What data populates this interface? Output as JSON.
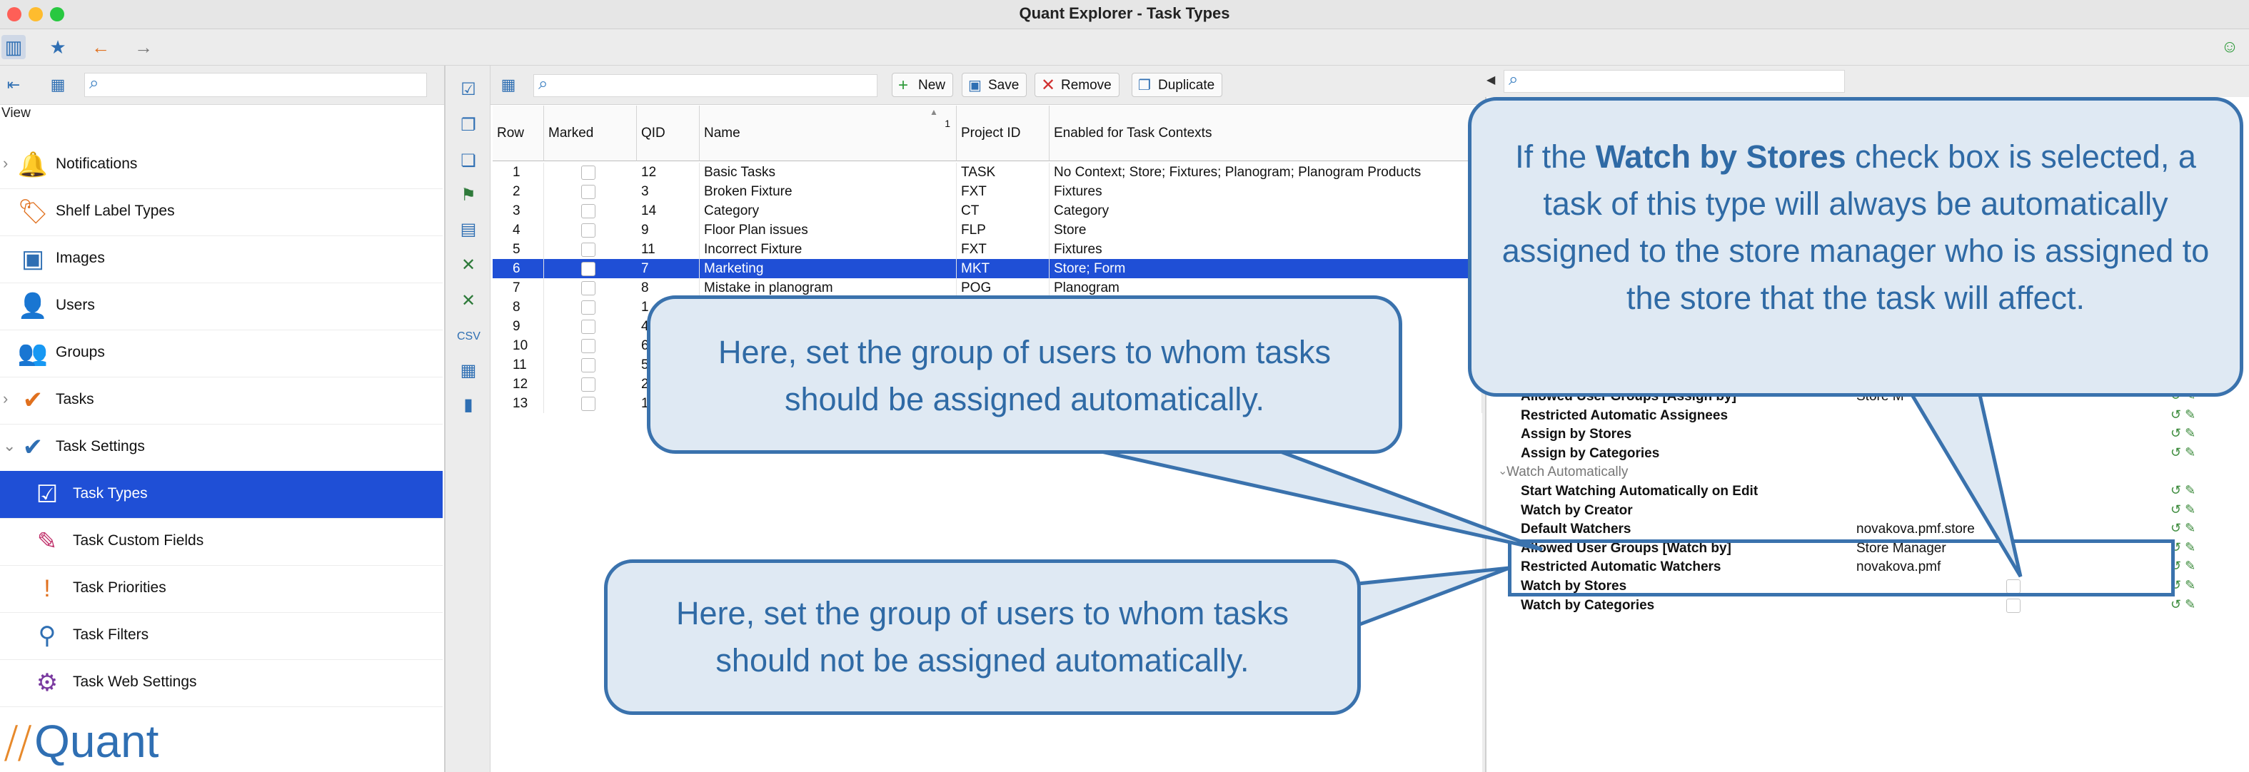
{
  "window": {
    "title": "Quant Explorer - Task Types"
  },
  "toolbar": {
    "icons": [
      "sidebar-toggle-icon",
      "star-icon",
      "back-arrow-icon",
      "forward-arrow-icon",
      "smiley-icon"
    ]
  },
  "left": {
    "search_placeholder": "",
    "view_label": "View",
    "items": [
      {
        "label": "Notifications",
        "icon": "bell-icon",
        "expandable": true
      },
      {
        "label": "Shelf Label Types",
        "icon": "label-icon",
        "expandable": false
      },
      {
        "label": "Images",
        "icon": "image-icon",
        "expandable": false
      },
      {
        "label": "Users",
        "icon": "user-icon",
        "expandable": false
      },
      {
        "label": "Groups",
        "icon": "group-icon",
        "expandable": false
      },
      {
        "label": "Tasks",
        "icon": "task-icon",
        "expandable": true
      },
      {
        "label": "Task Settings",
        "icon": "task-settings-icon",
        "expandable": true
      },
      {
        "label": "Task Types",
        "icon": "task-types-icon",
        "selected": true
      },
      {
        "label": "Task Custom Fields",
        "icon": "custom-fields-icon"
      },
      {
        "label": "Task Priorities",
        "icon": "priority-icon"
      },
      {
        "label": "Task Filters",
        "icon": "filter-icon"
      },
      {
        "label": "Task Web Settings",
        "icon": "web-settings-icon"
      }
    ],
    "logo_text": "Quant"
  },
  "middle": {
    "buttons": {
      "new": "New",
      "save": "Save",
      "remove": "Remove",
      "duplicate": "Duplicate"
    },
    "columns": [
      "Row",
      "Marked",
      "QID",
      "Name",
      "Project ID",
      "Enabled for Task Contexts"
    ],
    "sort_indicator": "1",
    "rows": [
      {
        "row": "1",
        "qid": "12",
        "name": "Basic Tasks",
        "pid": "TASK",
        "ctx": "No Context; Store; Fixtures; Planogram; Planogram Products"
      },
      {
        "row": "2",
        "qid": "3",
        "name": "Broken Fixture",
        "pid": "FXT",
        "ctx": "Fixtures"
      },
      {
        "row": "3",
        "qid": "14",
        "name": "Category",
        "pid": "CT",
        "ctx": "Category"
      },
      {
        "row": "4",
        "qid": "9",
        "name": "Floor Plan issues",
        "pid": "FLP",
        "ctx": "Store"
      },
      {
        "row": "5",
        "qid": "11",
        "name": "Incorrect Fixture",
        "pid": "FXT",
        "ctx": "Fixtures"
      },
      {
        "row": "6",
        "qid": "7",
        "name": "Marketing",
        "pid": "MKT",
        "ctx": "Store; Form",
        "selected": true
      },
      {
        "row": "7",
        "qid": "8",
        "name": "Mistake in planogram",
        "pid": "POG",
        "ctx": "Planogram"
      },
      {
        "row": "8",
        "qid": "1",
        "name": "",
        "pid": "",
        "ctx": ""
      },
      {
        "row": "9",
        "qid": "4",
        "name": "",
        "pid": "",
        "ctx": ""
      },
      {
        "row": "10",
        "qid": "6",
        "name": "",
        "pid": "",
        "ctx": ""
      },
      {
        "row": "11",
        "qid": "5",
        "name": "",
        "pid": "",
        "ctx": ""
      },
      {
        "row": "12",
        "qid": "2",
        "name": "",
        "pid": "",
        "ctx": ""
      },
      {
        "row": "13",
        "qid": "1",
        "name": "",
        "pid": "",
        "ctx": ""
      }
    ]
  },
  "right": {
    "properties": [
      {
        "name": "Allowed User Groups [Assign by]",
        "value": "Store M"
      },
      {
        "name": "Restricted Automatic Assignees",
        "value": ""
      },
      {
        "name": "Assign by Stores",
        "value": ""
      },
      {
        "name": "Assign by Categories",
        "value": ""
      },
      {
        "group": "Watch Automatically"
      },
      {
        "name": "Start Watching Automatically on Edit",
        "value": ""
      },
      {
        "name": "Watch by Creator",
        "value": ""
      },
      {
        "name": "Default Watchers",
        "value": "novakova.pmf.store"
      },
      {
        "name": "Allowed User Groups [Watch by]",
        "value": "Store Manager"
      },
      {
        "name": "Restricted Automatic Watchers",
        "value": "novakova.pmf"
      },
      {
        "name": "Watch by Stores",
        "value": "",
        "checkbox": true
      },
      {
        "name": "Watch by Categories",
        "value": "",
        "checkbox": true
      }
    ]
  },
  "callouts": {
    "watch_by_stores": {
      "pre": "If the ",
      "bold": "Watch by Stores",
      "post": " check box is selected, a task of this type will always be automatically assigned to the store manager who is assigned to the store that the task will affect."
    },
    "assign_group": "Here, set the group of users to whom tasks should be assigned automatically.",
    "not_assign_group": "Here, set the group of users to whom tasks should not be assigned automatically."
  },
  "colors": {
    "selection": "#1f4fd6",
    "callout_border": "#3a72ad",
    "callout_fill": "#dfe9f3",
    "callout_text": "#2f6aa5"
  }
}
